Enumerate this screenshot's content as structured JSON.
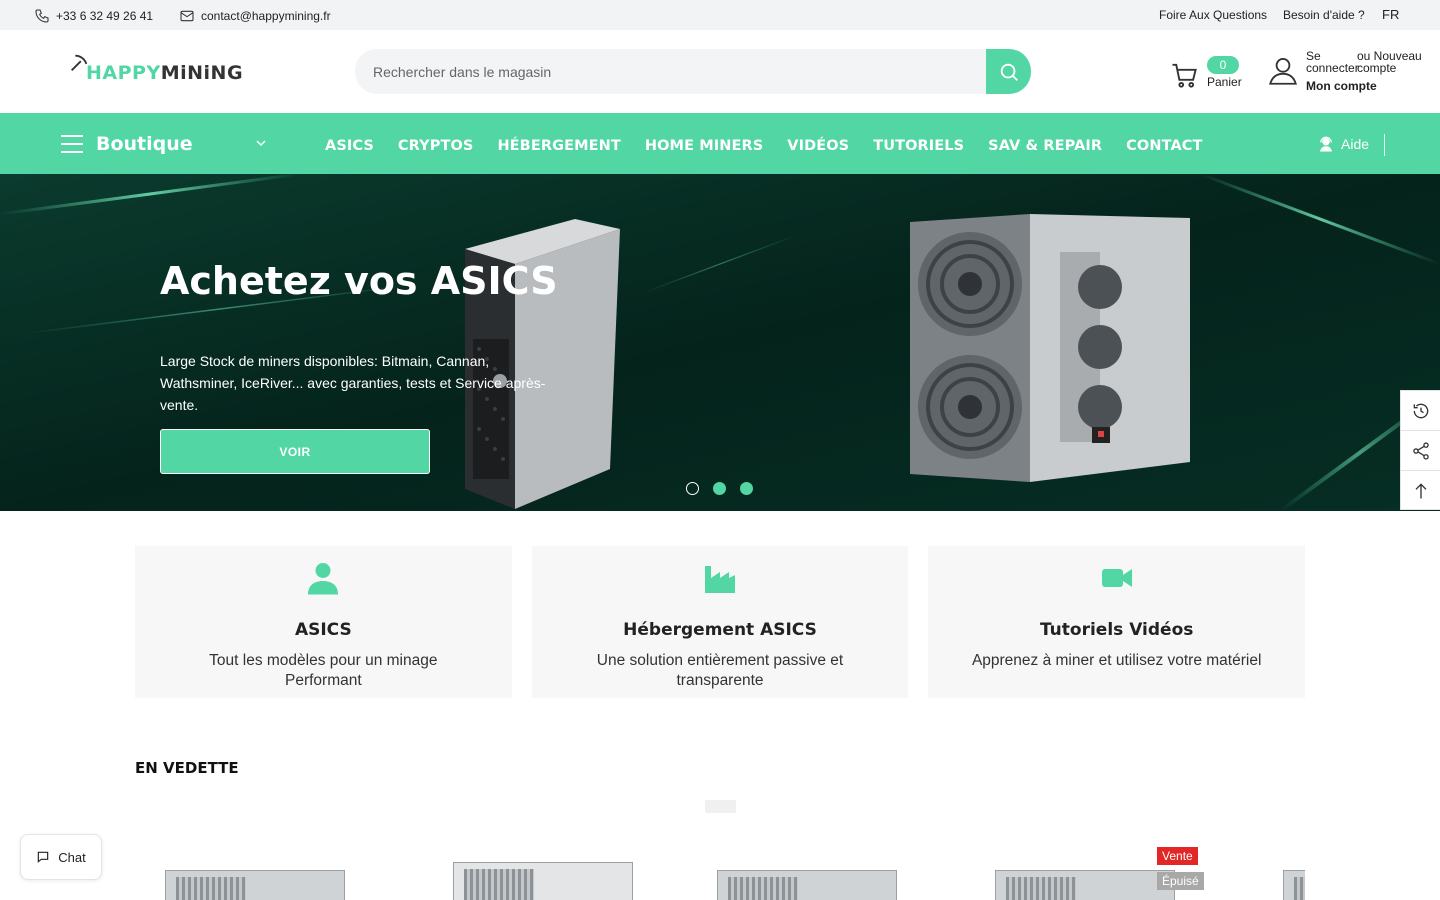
{
  "topbar": {
    "phone": "+33 6 32 49 26 41",
    "email": "contact@happymining.fr",
    "faq": "Foire Aux Questions",
    "help": "Besoin d'aide ?",
    "lang": "FR"
  },
  "header": {
    "logo_part1": "HAPPY",
    "logo_part2": "MiNiNG",
    "search_placeholder": "Rechercher dans le magasin",
    "cart_count": "0",
    "cart_label": "Panier",
    "login": "Se connecter",
    "register": "ou Nouveau compte",
    "account": "Mon compte"
  },
  "nav": {
    "boutique": "Boutique",
    "items": [
      "ASICS",
      "CRYPTOS",
      "HÉBERGEMENT",
      "HOME MINERS",
      "VIDÉOS",
      "TUTORIELS",
      "SAV & REPAIR",
      "CONTACT"
    ],
    "aide": "Aide"
  },
  "hero": {
    "title": "Achetez vos ASICS",
    "description": "Large Stock de miners disponibles: Bitmain, Cannan, Wathsminer, IceRiver... avec garanties, tests et Service après-vente.",
    "button": "VOIR",
    "active_slide": 2,
    "slide_count": 3
  },
  "features": [
    {
      "title": "ASICS",
      "desc": "Tout les modèles pour un minage Performant",
      "icon": "user-icon"
    },
    {
      "title": "Hébergement ASICS",
      "desc": "Une solution entièrement passive et transparente",
      "icon": "factory-icon"
    },
    {
      "title": "Tutoriels Vidéos",
      "desc": "Apprenez à miner et utilisez votre matériel",
      "icon": "video-camera-icon"
    }
  ],
  "featured": {
    "title": "EN VEDETTE",
    "badge_sale": "Vente",
    "badge_out": "Épuisé"
  },
  "chat": {
    "label": "Chat"
  },
  "colors": {
    "accent": "#52d6a4",
    "hero_bg": "#05281f",
    "sale": "#e32626"
  }
}
